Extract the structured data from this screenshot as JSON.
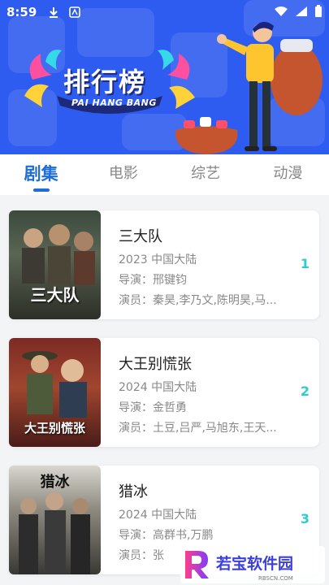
{
  "status_bar": {
    "time": "8:59",
    "left_icons": [
      "download-icon",
      "app-icon"
    ],
    "right_icons": [
      "wifi-icon",
      "signal-icon",
      "battery-icon"
    ]
  },
  "banner": {
    "title": "排行榜",
    "subtitle": "PAI HANG BANG",
    "background_color": "#2f5cf0"
  },
  "tabs": [
    {
      "label": "剧集",
      "active": true
    },
    {
      "label": "电影",
      "active": false
    },
    {
      "label": "综艺",
      "active": false
    },
    {
      "label": "动漫",
      "active": false
    }
  ],
  "items": [
    {
      "title": "三大队",
      "year_region": "2023 中国大陆",
      "director": "导演：邢键钧",
      "cast": "演员：秦昊,李乃文,陈明昊,马...",
      "rank": "1",
      "poster_text": "三大队"
    },
    {
      "title": "大王别慌张",
      "year_region": "2024 中国大陆",
      "director": "导演：金哲勇",
      "cast": "演员：土豆,吕严,马旭东,王天...",
      "rank": "2",
      "poster_text": "大王别慌张"
    },
    {
      "title": "猎冰",
      "year_region": "2024 中国大陆",
      "director": "导演：高群书,万鹏",
      "cast": "演员：张",
      "rank": "3",
      "poster_text": "猎冰"
    }
  ],
  "watermark": {
    "brand": "若宝软件园",
    "site": "RBSCN.COM"
  },
  "colors": {
    "accent": "#1e6ddc",
    "rank": "#2ecbd0"
  }
}
